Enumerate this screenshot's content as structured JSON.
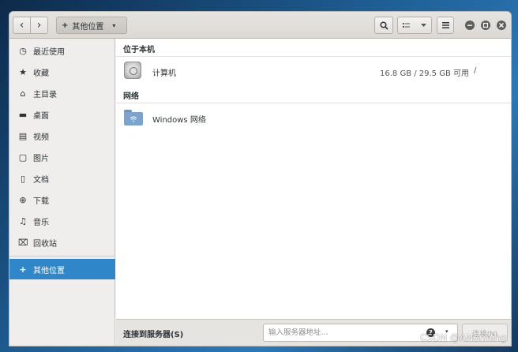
{
  "header": {
    "path_label": "其他位置",
    "path_prefix": "+",
    "path_caret": "▾",
    "back_glyph": "‹",
    "forward_glyph": "›",
    "search_icon": "search-icon",
    "view_icon": "list-view-icon",
    "menu_icon": "hamburger-menu-icon"
  },
  "sidebar": {
    "items": [
      {
        "label": "最近使用",
        "icon": "recent-clock-icon",
        "glyph": "◷"
      },
      {
        "label": "收藏",
        "icon": "star-icon",
        "glyph": "★"
      },
      {
        "label": "主目录",
        "icon": "home-icon",
        "glyph": "⌂"
      },
      {
        "label": "桌面",
        "icon": "desktop-icon",
        "glyph": "▬"
      },
      {
        "label": "视频",
        "icon": "video-icon",
        "glyph": "▤"
      },
      {
        "label": "图片",
        "icon": "picture-icon",
        "glyph": "▢"
      },
      {
        "label": "文档",
        "icon": "document-icon",
        "glyph": "▯"
      },
      {
        "label": "下载",
        "icon": "download-icon",
        "glyph": "⊕"
      },
      {
        "label": "音乐",
        "icon": "music-icon",
        "glyph": "♫"
      },
      {
        "label": "回收站",
        "icon": "trash-icon",
        "glyph": "⌧"
      }
    ],
    "other_locations": {
      "label": "其他位置",
      "glyph": "+"
    }
  },
  "content": {
    "local_section_title": "位于本机",
    "computer_label": "计算机",
    "computer_usage": "16.8 GB / 29.5 GB 可用",
    "computer_mount": "/",
    "network_section_title": "网络",
    "network_label": "Windows 网络"
  },
  "footer": {
    "label": "连接到服务器(S)",
    "input_placeholder": "输入服务器地址...",
    "help_glyph": "?",
    "dropdown_glyph": "▾",
    "connect_label": "连接(N)"
  },
  "watermark": "CSDN @ANorming",
  "colors": {
    "accent": "#2f86c9",
    "sidebar_bg": "#efeeec",
    "header_bg": "#dcd9d5"
  }
}
